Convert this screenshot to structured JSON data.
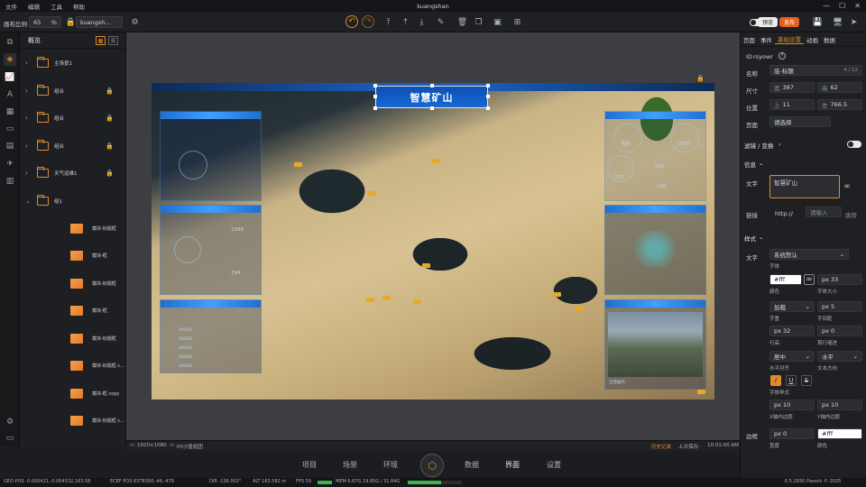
{
  "menubar": {
    "items": [
      "文件",
      "编辑",
      "工具",
      "帮助"
    ],
    "title": "kuangshan",
    "win": [
      "—",
      "☐",
      "✕"
    ]
  },
  "toolbar": {
    "zoom_label": "画布比例",
    "zoom_value": "65",
    "zoom_unit": "%",
    "project_name": "kuangsh...",
    "preview_label": "预览",
    "publish_label": "发布"
  },
  "layers": {
    "header": "概览",
    "items": [
      {
        "type": "folder",
        "name": "主场景1",
        "locked": false
      },
      {
        "type": "folder",
        "name": "组合",
        "locked": true
      },
      {
        "type": "folder",
        "name": "组合",
        "locked": true
      },
      {
        "type": "folder",
        "name": "组合",
        "locked": true
      },
      {
        "type": "folder",
        "name": "天气运维1",
        "locked": true
      },
      {
        "type": "folder-open",
        "name": "组1",
        "locked": false
      },
      {
        "type": "image",
        "name": "模块-标题框",
        "locked": false
      },
      {
        "type": "image",
        "name": "模块-框",
        "locked": false
      },
      {
        "type": "image",
        "name": "模块-标题框",
        "locked": false
      },
      {
        "type": "image",
        "name": "模块-框",
        "locked": false
      },
      {
        "type": "image",
        "name": "模块-标题框",
        "locked": false
      },
      {
        "type": "image",
        "name": "模块-标题框 c...",
        "locked": false
      },
      {
        "type": "image",
        "name": "模块-框 copy",
        "locked": false
      },
      {
        "type": "image",
        "name": "模块-标题框 c...",
        "locked": false
      }
    ]
  },
  "canvas": {
    "scene_title": "智慧矿山",
    "stats": {
      "s1": "良好",
      "s2": "1729",
      "s3": "582",
      "s4": "275",
      "s5": "186",
      "s6": "1568",
      "s7": "394"
    },
    "table_rows": [
      "XXX01",
      "XXX02",
      "XXX03",
      "XXX04",
      "XXX05"
    ],
    "resolution": "1920×1080",
    "scene_info": "P0沙盘组团",
    "history": "历史记录",
    "last_save_label": "上次保存:",
    "last_save_time": "10:01:00 AM",
    "photo_caption": "全景展示"
  },
  "bottomnav": {
    "tabs": [
      "项目",
      "场景",
      "环境",
      "数据",
      "界面",
      "设置"
    ],
    "active": "界面"
  },
  "status": {
    "geo": "GEO POS  -0.000421,-0.004332,163.58",
    "ecef": "ECEF POS  6378300,-46,-479",
    "dir": "DIR  -136.002°",
    "alt": "ALT  163.582 m",
    "fps": "FPS  59",
    "mem": "MEM  6.87G  19.85G / 31.84G",
    "right": "6.5.2830   Piaoshi © 2025",
    "mem_ratio": 0.62
  },
  "props": {
    "tabs": [
      "页面",
      "事件",
      "基础设置",
      "动画",
      "数据"
    ],
    "active_tab": "基础设置",
    "id_label": "ID",
    "id_value": "rsyowr",
    "name_label": "名称",
    "name_value": "底-标题",
    "name_count": "4 / 12",
    "size_label": "尺寸",
    "width_label": "宽",
    "width_value": "387",
    "height_label": "高",
    "height_value": "62",
    "pos_label": "位置",
    "top_label": "上",
    "top_value": "11",
    "left_label": "左",
    "left_value": "766.5",
    "page_label": "页面",
    "page_value": "请选择",
    "filter_label": "滤镜 / 变换",
    "info_label": "信息",
    "text_label": "文字",
    "text_value": "智慧矿山",
    "link_label": "链接",
    "link_prefix": "http://",
    "link_placeholder": "请输入",
    "link_jump": "跳转",
    "style_label": "样式",
    "font_label": "文字",
    "font_value": "系统默认",
    "font_sub": "字体",
    "color_value": "#fff",
    "color_sub": "颜色",
    "size_value": "px 33",
    "size_sub": "字体大小",
    "weight_value": "加粗",
    "weight_sub": "字重",
    "spacing_value": "px 5",
    "spacing_sub": "字间距",
    "lh_value": "px 32",
    "lh_sub": "行高",
    "indent_value": "px 0",
    "indent_sub": "首行缩进",
    "align_value": "居中",
    "align_sub": "水平对齐",
    "dir_value": "水平",
    "dir_sub": "文本方向",
    "fontstyle_sub": "字体样式",
    "padx_value": "px 10",
    "padx_sub": "X轴内边距",
    "pady_value": "px 10",
    "pady_sub": "Y轴内边距",
    "border_label": "边框",
    "bw_value": "px 0",
    "bw_sub": "宽度",
    "bc_value": "#fff",
    "bc_sub": "颜色"
  },
  "colors": {
    "accent": "#e08a2a",
    "publish": "#e8601c",
    "scene_blue": "#1769d6"
  }
}
